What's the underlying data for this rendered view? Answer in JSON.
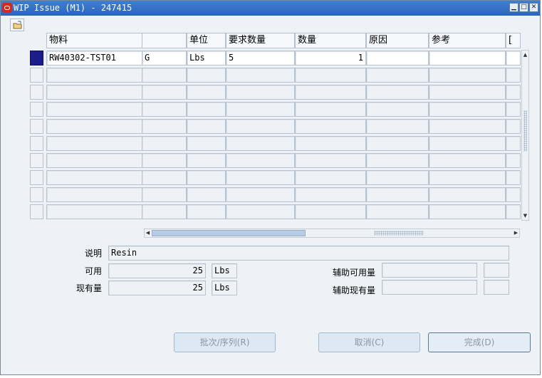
{
  "window": {
    "title": "WIP Issue (M1) - 247415",
    "minimize": "▁",
    "maximize": "□",
    "close": "✕"
  },
  "table": {
    "headers": [
      "物料",
      "",
      "单位",
      "要求数量",
      "数量",
      "原因",
      "参考",
      "["
    ],
    "rows": [
      [
        "RW40302-TST01",
        "G",
        "Lbs",
        "5",
        "1",
        "",
        "",
        ""
      ],
      [
        "",
        "",
        "",
        "",
        "",
        "",
        "",
        ""
      ],
      [
        "",
        "",
        "",
        "",
        "",
        "",
        "",
        ""
      ],
      [
        "",
        "",
        "",
        "",
        "",
        "",
        "",
        ""
      ],
      [
        "",
        "",
        "",
        "",
        "",
        "",
        "",
        ""
      ],
      [
        "",
        "",
        "",
        "",
        "",
        "",
        "",
        ""
      ],
      [
        "",
        "",
        "",
        "",
        "",
        "",
        "",
        ""
      ],
      [
        "",
        "",
        "",
        "",
        "",
        "",
        "",
        ""
      ],
      [
        "",
        "",
        "",
        "",
        "",
        "",
        "",
        ""
      ],
      [
        "",
        "",
        "",
        "",
        "",
        "",
        "",
        ""
      ]
    ]
  },
  "details": {
    "description_label": "说明",
    "description_value": "Resin",
    "available_label": "可用",
    "available_value": "25",
    "available_uom": "Lbs",
    "onhand_label": "现有量",
    "onhand_value": "25",
    "onhand_uom": "Lbs",
    "secondary_available_label": "辅助可用量",
    "secondary_available_value": "",
    "secondary_available_uom": "",
    "secondary_onhand_label": "辅助现有量",
    "secondary_onhand_value": "",
    "secondary_onhand_uom": ""
  },
  "buttons": {
    "lot_serial": "批次/序列(R)",
    "cancel": "取消(C)",
    "done": "完成(D)"
  }
}
